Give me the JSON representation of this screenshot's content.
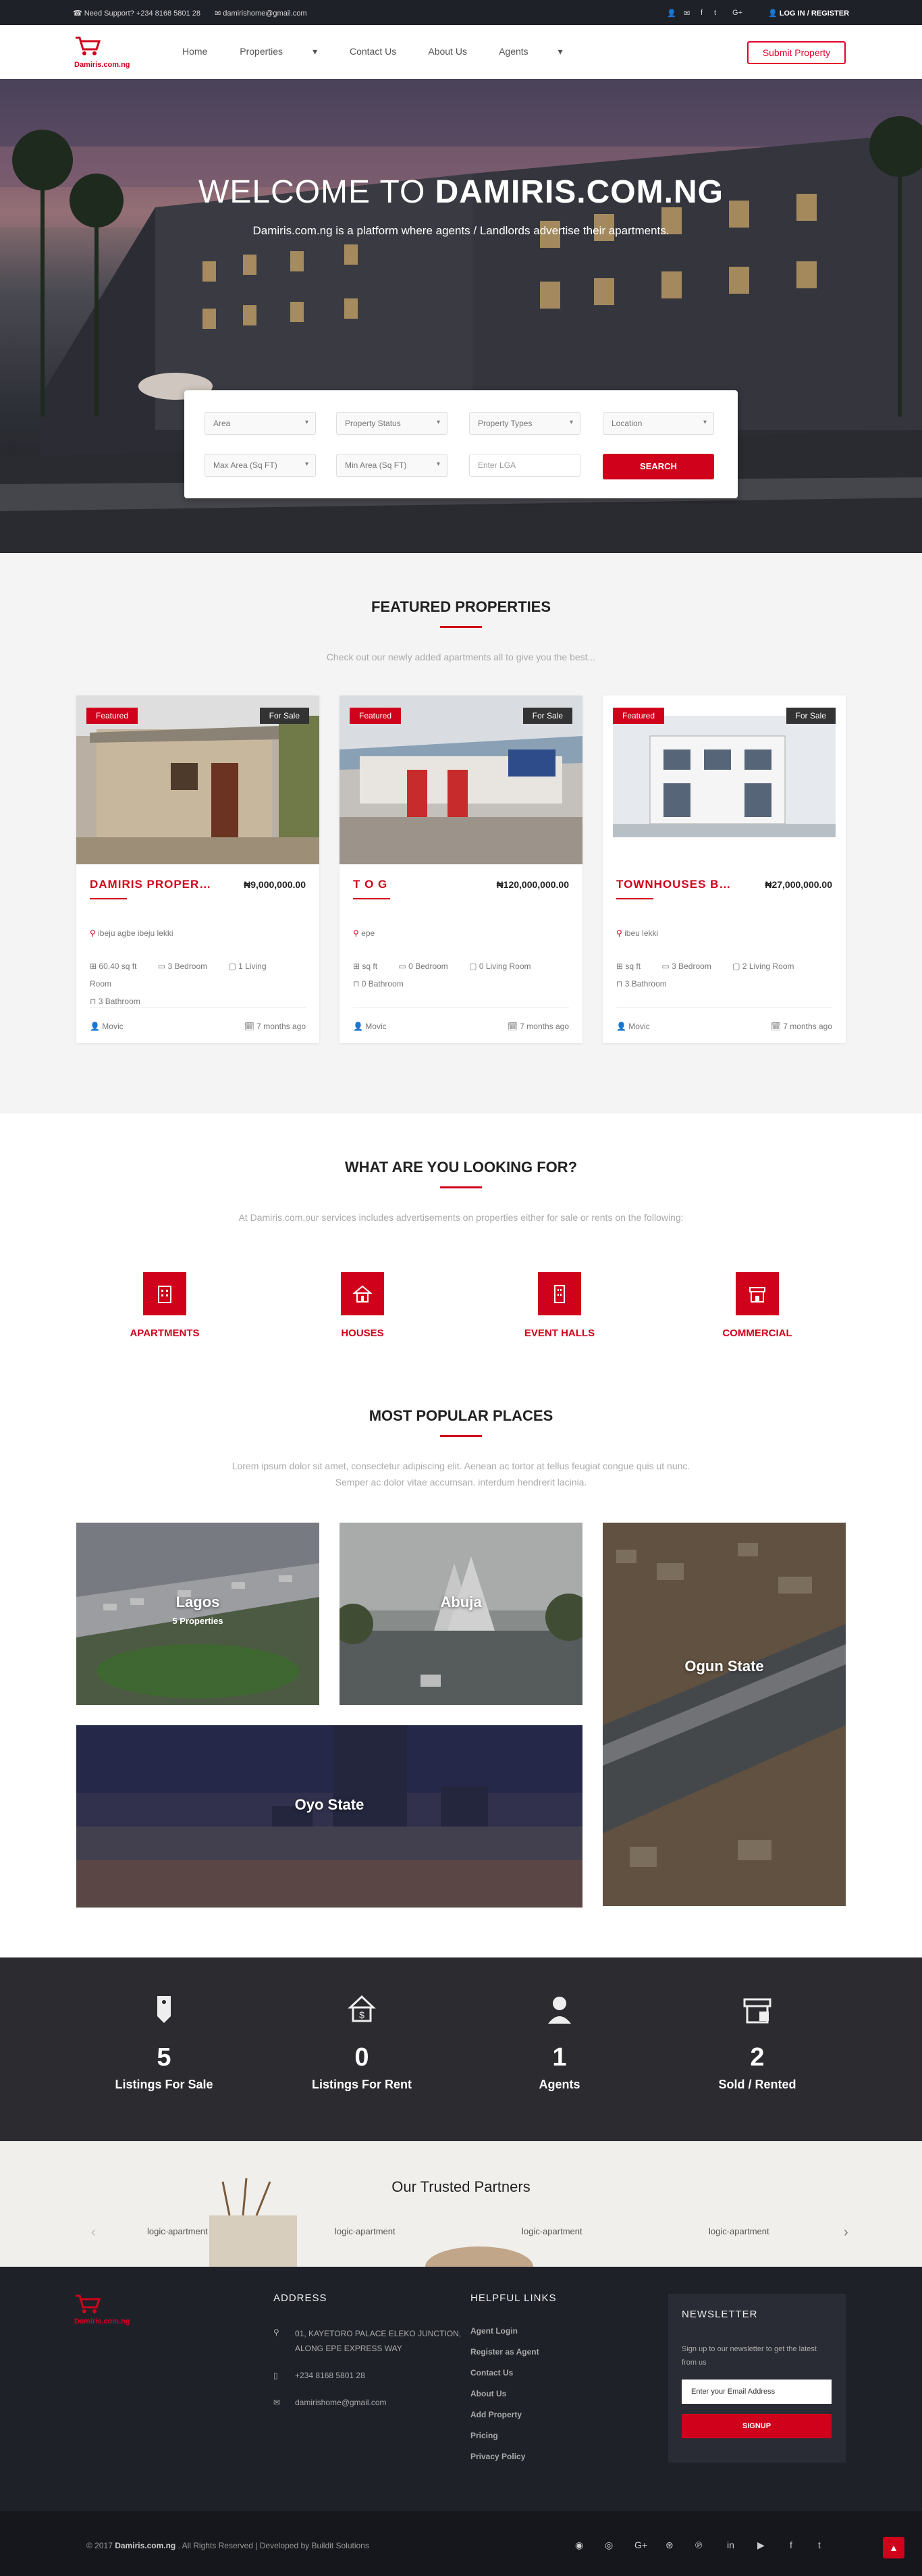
{
  "topbar": {
    "support": "Need Support? +234 8168 5801 28",
    "email": "damirishome@gmail.com",
    "login": "LOG IN / REGISTER"
  },
  "nav": {
    "logo_text": "Damiris.com.ng",
    "items": [
      "Home",
      "Properties",
      "Contact Us",
      "About Us",
      "Agents"
    ],
    "submit": "Submit Property"
  },
  "hero": {
    "title_light": "WELCOME TO ",
    "title_bold": "DAMIRIS.COM.NG",
    "subtitle": "Damiris.com.ng is a platform where agents / Landlords advertise their apartments."
  },
  "search": {
    "area": "Area",
    "status": "Property Status",
    "types": "Property Types",
    "location": "Location",
    "max_area": "Max Area (Sq FT)",
    "min_area": "Min Area (Sq FT)",
    "lga_placeholder": "Enter LGA",
    "button": "SEARCH"
  },
  "featured": {
    "title": "FEATURED PROPERTIES",
    "desc": "Check out our newly added apartments all to give you the best...",
    "cards": [
      {
        "badge": "Featured",
        "status": "For Sale",
        "title": "DAMIRIS PROPERTY...",
        "price": "₦9,000,000.00",
        "location": "ibeju agbe ibeju lekki",
        "size": "60,40 sq ft",
        "bedroom": "3 Bedroom",
        "living": "1 Living Room",
        "bathroom": "3 Bathroom",
        "agent": "Movic",
        "time": "7 months ago"
      },
      {
        "badge": "Featured",
        "status": "For Sale",
        "title": "T O G",
        "price": "₦120,000,000.00",
        "location": "epe",
        "size": "sq ft",
        "bedroom": "0 Bedroom",
        "living": "0 Living Room",
        "bathroom": "0 Bathroom",
        "agent": "Movic",
        "time": "7 months ago"
      },
      {
        "badge": "Featured",
        "status": "For Sale",
        "title": "TOWNHOUSES BEING...",
        "price": "₦27,000,000.00",
        "location": "ibeu lekki",
        "size": "sq ft",
        "bedroom": "3 Bedroom",
        "living": "2 Living Room",
        "bathroom": "3 Bathroom",
        "agent": "Movic",
        "time": "7 months ago"
      }
    ]
  },
  "lookfor": {
    "title": "WHAT ARE YOU LOOKING FOR?",
    "desc": "At Damiris.com,our services includes advertisements on properties either for sale or rents on the following:",
    "categories": [
      "APARTMENTS",
      "HOUSES",
      "EVENT HALLS",
      "COMMERCIAL"
    ]
  },
  "places": {
    "title": "MOST POPULAR PLACES",
    "desc": "Lorem ipsum dolor sit amet, consectetur adipiscing elit. Aenean ac tortor at tellus feugiat congue quis ut nunc. Semper ac dolor vitae accumsan. interdum hendrerit lacinia.",
    "items": [
      {
        "name": "Lagos",
        "count": "5 Properties"
      },
      {
        "name": "Abuja",
        "count": ""
      },
      {
        "name": "Ogun State",
        "count": ""
      },
      {
        "name": "Oyo State",
        "count": ""
      }
    ]
  },
  "stats": [
    {
      "num": "5",
      "label": "Listings For Sale"
    },
    {
      "num": "0",
      "label": "Listings For Rent"
    },
    {
      "num": "1",
      "label": "Agents"
    },
    {
      "num": "2",
      "label": "Sold / Rented"
    }
  ],
  "partners": {
    "title": "Our Trusted Partners",
    "logos": [
      "logic-apartment",
      "logic-apartment",
      "logic-apartment",
      "logic-apartment"
    ]
  },
  "footer": {
    "address_title": "ADDRESS",
    "address_line1": "01, KAYETORO PALACE ELEKO JUNCTION,",
    "address_line2": "ALONG EPE EXPRESS WAY",
    "phone": "+234 8168 5801 28",
    "email": "damirishome@gmail.com",
    "links_title": "HELPFUL LINKS",
    "links": [
      "Agent Login",
      "Register as Agent",
      "Contact Us",
      "About Us",
      "Add Property",
      "Pricing",
      "Privacy Policy"
    ],
    "news_title": "NEWSLETTER",
    "news_desc": "Sign up to our newsletter to get the latest from us",
    "news_placeholder": "Enter your Email Address",
    "news_button": "SIGNUP",
    "copy_prefix": "© 2017 ",
    "copy_brand": "Damiris.com.ng",
    "copy_suffix": " . All Rights Reserved  |  Developed by Buildit Solutions"
  }
}
